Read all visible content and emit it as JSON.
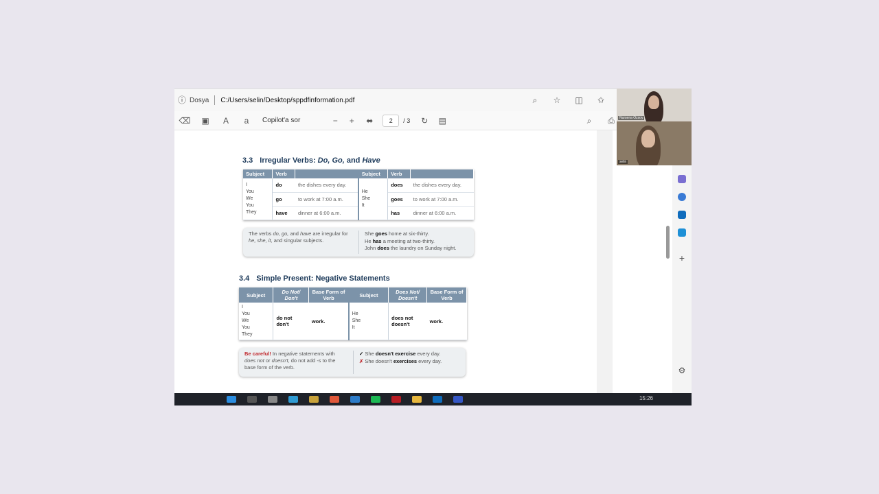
{
  "address_bar": {
    "tab_label": "Dosya",
    "url": "C:/Users/selin/Desktop/sppdfinformation.pdf"
  },
  "pdf_toolbar": {
    "copilot_label": "Copilot'a sor",
    "zoom_out": "−",
    "zoom_in": "+",
    "page_current": "2",
    "page_total": "/ 3"
  },
  "section_33": {
    "number": "3.3",
    "title_prefix": "Irregular Verbs: ",
    "title_italic": "Do, Go,",
    "title_and": " and ",
    "title_italic2": "Have",
    "headers": [
      "Subject",
      "Verb",
      "",
      "Subject",
      "Verb",
      ""
    ],
    "left_subjects": "I\nYou\nWe\nYou\nThey",
    "right_subjects": "He\nShe\nIt",
    "rows": [
      {
        "lv": "do",
        "lc": "the dishes every day.",
        "rv": "does",
        "rc": "the dishes every day."
      },
      {
        "lv": "go",
        "lc": "to work at 7:00 a.m.",
        "rv": "goes",
        "rc": "to work at 7:00 a.m."
      },
      {
        "lv": "have",
        "lc": "dinner at 6:00 a.m.",
        "rv": "has",
        "rc": "dinner at 6:00 a.m."
      }
    ],
    "note_left_1": "The verbs ",
    "note_left_do": "do, go,",
    "note_left_2": " and ",
    "note_left_have": "have",
    "note_left_3": " are irregular for ",
    "note_left_hsi": "he, she, it,",
    "note_left_4": " and singular subjects.",
    "note_r1_pre": "She ",
    "note_r1_b": "goes",
    "note_r1_post": " home at six-thirty.",
    "note_r2_pre": "He ",
    "note_r2_b": "has",
    "note_r2_post": " a meeting at two-thirty.",
    "note_r3_pre": "John ",
    "note_r3_b": "does",
    "note_r3_post": " the laundry on Sunday night."
  },
  "section_34": {
    "number": "3.4",
    "title": "Simple Present: Negative Statements",
    "headers": [
      "Subject",
      "Do Not/ Don't",
      "Base Form of Verb",
      "Subject",
      "Does Not/ Doesn't",
      "Base Form of Verb"
    ],
    "left_subjects": "I\nYou\nWe\nYou\nThey",
    "right_subjects": "He\nShe\nIt",
    "left_neg": "do not\ndon't",
    "left_verb": "work.",
    "right_neg": "does not\ndoesn't",
    "right_verb": "work.",
    "note_careful": "Be careful!",
    "note_left_1": " In negative statements with ",
    "note_left_dn": "does not",
    "note_left_2": " or ",
    "note_left_dsnt": "doesn't",
    "note_left_3": ", do not add ",
    "note_left_s": "-s",
    "note_left_4": " to the base form of the verb.",
    "check_mark": "✓",
    "cross_mark": "✗",
    "note_r1_pre": " She ",
    "note_r1_b": "doesn't exercise",
    "note_r1_post": " every day.",
    "note_r2_pre": " She doesn't ",
    "note_r2_b": "exercises",
    "note_r2_post": " every day."
  },
  "taskbar": {
    "clock": "15:26"
  },
  "video": {
    "tile1_name": "Nursena Özsoy",
    "tile2_name": "selin"
  },
  "colors": {
    "table_header": "#7c93a9",
    "title": "#1d3a5a",
    "careful": "#c0282d"
  }
}
